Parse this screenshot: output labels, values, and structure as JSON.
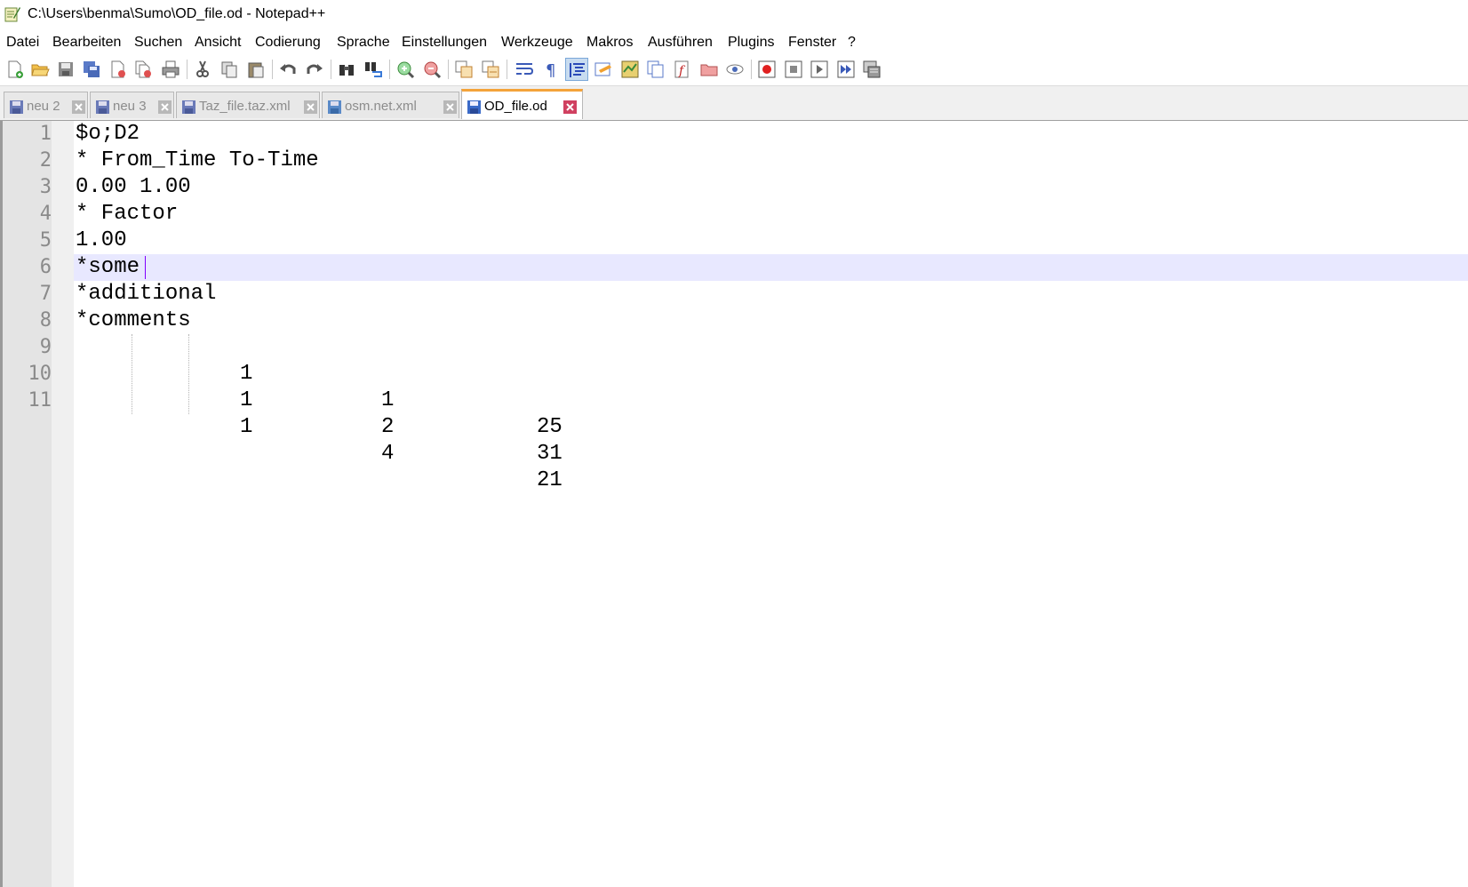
{
  "window": {
    "title": "C:\\Users\\benma\\Sumo\\OD_file.od - Notepad++",
    "app_icon": "notepad-plus-plus-icon"
  },
  "menu": {
    "items": [
      "Datei",
      "Bearbeiten",
      "Suchen",
      "Ansicht",
      "Codierung",
      "Sprache",
      "Einstellungen",
      "Werkzeuge",
      "Makros",
      "Ausführen",
      "Plugins",
      "Fenster",
      "?"
    ]
  },
  "toolbar": {
    "buttons": [
      "new-file-icon",
      "open-file-icon",
      "save-icon",
      "save-all-icon",
      "close-icon",
      "close-all-icon",
      "print-icon",
      "cut-icon",
      "copy-icon",
      "paste-icon",
      "undo-icon",
      "redo-icon",
      "find-icon",
      "replace-icon",
      "zoom-in-icon",
      "zoom-out-icon",
      "sync-vertical-icon",
      "sync-horizontal-icon",
      "word-wrap-icon",
      "show-all-chars-icon",
      "indent-guide-icon",
      "udl-icon",
      "document-map-icon",
      "document-list-icon",
      "function-list-icon",
      "folder-workspace-icon",
      "monitoring-icon",
      "macro-record-icon",
      "macro-stop-icon",
      "macro-play-icon",
      "macro-run-multiple-icon",
      "macro-save-icon"
    ],
    "pressed": "indent-guide-icon"
  },
  "tabs": [
    {
      "label": "neu 2",
      "active": false
    },
    {
      "label": "neu 3",
      "active": false
    },
    {
      "label": "Taz_file.taz.xml",
      "active": false
    },
    {
      "label": "osm.net.xml",
      "active": false
    },
    {
      "label": "OD_file.od",
      "active": true
    }
  ],
  "editor": {
    "current_line": 6,
    "lines": [
      {
        "num": "1",
        "text": "$o;D2"
      },
      {
        "num": "2",
        "text": "* From_Time To-Time"
      },
      {
        "num": "3",
        "text": "0.00 1.00"
      },
      {
        "num": "4",
        "text": "* Factor"
      },
      {
        "num": "5",
        "text": "1.00"
      },
      {
        "num": "6",
        "text": "*some"
      },
      {
        "num": "7",
        "text": "*additional"
      },
      {
        "num": "8",
        "text": "*comments"
      },
      {
        "num": "9",
        "cells": [
          "1",
          "1",
          "25"
        ]
      },
      {
        "num": "10",
        "cells": [
          "1",
          "2",
          "31"
        ]
      },
      {
        "num": "11",
        "cells": [
          "1",
          "4",
          "21"
        ]
      }
    ]
  },
  "colors": {
    "current_line_bg": "#e8e8ff",
    "caret": "#8000ff",
    "active_tab_accent": "#f4a33a"
  }
}
